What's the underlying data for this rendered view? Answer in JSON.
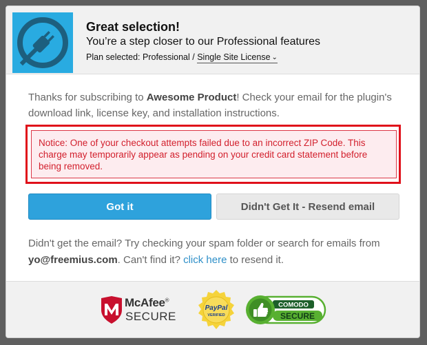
{
  "header": {
    "logo_icon": "plug-icon",
    "title": "Great selection!",
    "subtitle": "You’re a step closer to our Professional features",
    "plan_prefix": "Plan selected: Professional / ",
    "plan_value": "Single Site License",
    "plan_chevron": "⌄"
  },
  "body": {
    "intro_pre": "Thanks for subscribing to ",
    "product_name": "Awesome Product",
    "intro_post": "! Check your email for the plugin's download link, license key, and installation instructions.",
    "notice": "Notice: One of your checkout attempts failed due to an incorrect ZIP Code. This charge may temporarily appear as pending on your credit card statement before being removed."
  },
  "buttons": {
    "got_it": "Got it",
    "resend": "Didn't Get It - Resend email"
  },
  "footer": {
    "text_pre": "Didn't get the email? Try checking your spam folder or search for emails from ",
    "email": "yo@freemius.com",
    "text_mid": ". Can't find it? ",
    "link": "click here",
    "text_post": " to resend it."
  },
  "badges": {
    "mcafee_name": "McAfee",
    "mcafee_reg": "®",
    "mcafee_secure": "SECURE",
    "paypal_top": "PayPal",
    "paypal_bottom": "VERIFIED",
    "comodo_top": "COMODO",
    "comodo_bottom": "SECURE"
  },
  "colors": {
    "accent_blue": "#2ea2dc",
    "logo_blue": "#29abe1",
    "notice_red": "#d21f2c",
    "highlight_red": "#e0101a"
  }
}
